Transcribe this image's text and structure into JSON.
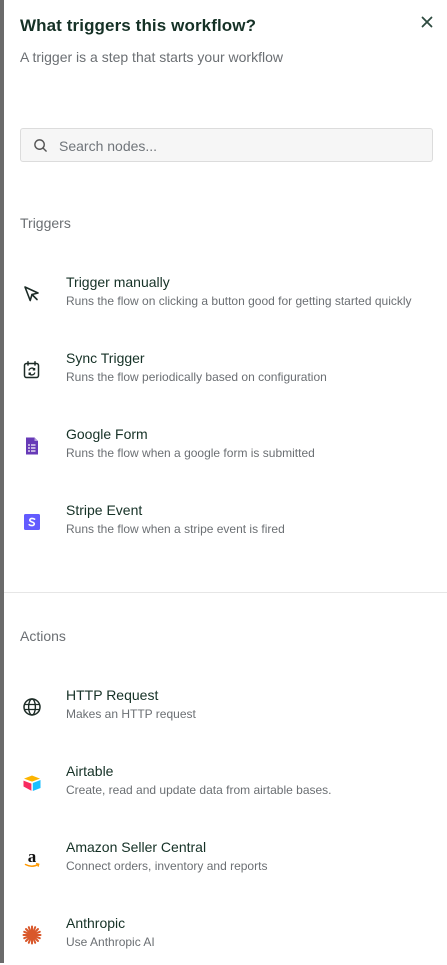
{
  "header": {
    "title": "What triggers this workflow?",
    "subtitle": "A trigger is a step that starts your workflow",
    "close_icon": "close-icon"
  },
  "search": {
    "placeholder": "Search nodes...",
    "value": "",
    "icon": "search-icon"
  },
  "sections": {
    "triggers_label": "Triggers",
    "actions_label": "Actions"
  },
  "triggers": [
    {
      "name": "Trigger manually",
      "description": "Runs the flow on clicking a button good for getting started quickly",
      "icon": "cursor-icon"
    },
    {
      "name": "Sync Trigger",
      "description": "Runs the flow periodically based on configuration",
      "icon": "calendar-sync-icon"
    },
    {
      "name": "Google Form",
      "description": "Runs the flow when a google form is submitted",
      "icon": "google-forms-icon",
      "color": "#673ab7"
    },
    {
      "name": "Stripe Event",
      "description": "Runs the flow when a stripe event is fired",
      "icon": "stripe-icon",
      "color": "#635bff"
    }
  ],
  "actions": [
    {
      "name": "HTTP Request",
      "description": "Makes an HTTP request",
      "icon": "globe-icon"
    },
    {
      "name": "Airtable",
      "description": "Create, read and update data from airtable bases.",
      "icon": "airtable-icon"
    },
    {
      "name": "Amazon Seller Central",
      "description": "Connect orders, inventory and reports",
      "icon": "amazon-icon",
      "color": "#ff9900"
    },
    {
      "name": "Anthropic",
      "description": "Use Anthropic AI",
      "icon": "anthropic-icon",
      "color": "#d9582b"
    }
  ]
}
